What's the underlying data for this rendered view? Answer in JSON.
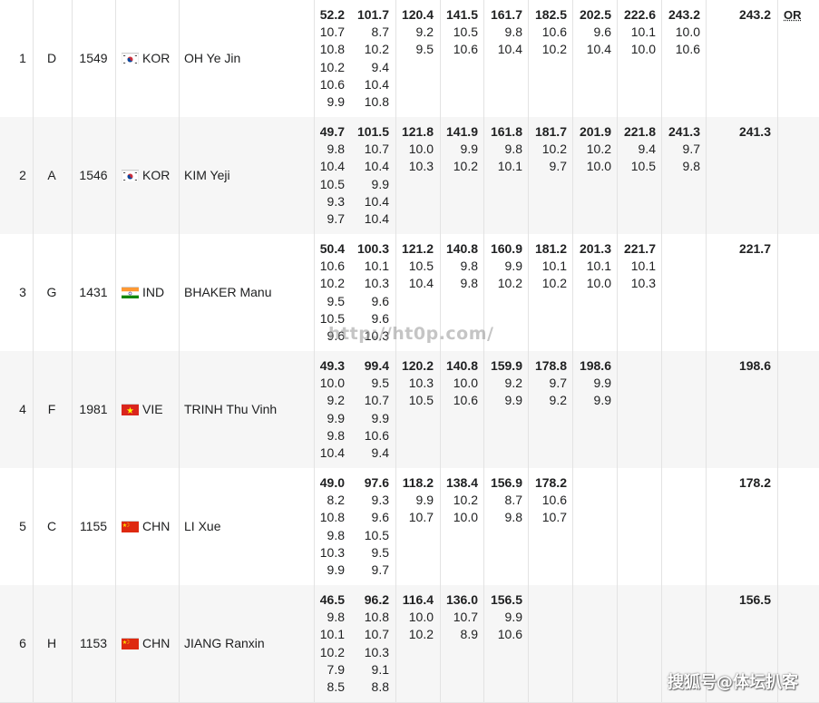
{
  "columns_note": "",
  "rows": [
    {
      "rank": "1",
      "relay": "D",
      "bib": "1549",
      "noc": "KOR",
      "flag": "korea-flag-icon",
      "name": "OH Ye Jin",
      "stages": [
        {
          "sum": "52.2",
          "shots": [
            "10.7",
            "10.8",
            "10.2",
            "10.6",
            "9.9"
          ]
        },
        {
          "sum": "101.7",
          "shots": [
            "8.7",
            "10.2",
            "9.4",
            "10.4",
            "10.8"
          ]
        },
        {
          "sum": "120.4",
          "shots": [
            "9.2",
            "9.5"
          ]
        },
        {
          "sum": "141.5",
          "shots": [
            "10.5",
            "10.6"
          ]
        },
        {
          "sum": "161.7",
          "shots": [
            "9.8",
            "10.4"
          ]
        },
        {
          "sum": "182.5",
          "shots": [
            "10.6",
            "10.2"
          ]
        },
        {
          "sum": "202.5",
          "shots": [
            "9.6",
            "10.4"
          ]
        },
        {
          "sum": "222.6",
          "shots": [
            "10.1",
            "10.0"
          ]
        },
        {
          "sum": "243.2",
          "shots": [
            "10.0",
            "10.6"
          ]
        }
      ],
      "final": "243.2",
      "note": "OR"
    },
    {
      "rank": "2",
      "relay": "A",
      "bib": "1546",
      "noc": "KOR",
      "flag": "korea-flag-icon",
      "name": "KIM Yeji",
      "stages": [
        {
          "sum": "49.7",
          "shots": [
            "9.8",
            "10.4",
            "10.5",
            "9.3",
            "9.7"
          ]
        },
        {
          "sum": "101.5",
          "shots": [
            "10.7",
            "10.4",
            "9.9",
            "10.4",
            "10.4"
          ]
        },
        {
          "sum": "121.8",
          "shots": [
            "10.0",
            "10.3"
          ]
        },
        {
          "sum": "141.9",
          "shots": [
            "9.9",
            "10.2"
          ]
        },
        {
          "sum": "161.8",
          "shots": [
            "9.8",
            "10.1"
          ]
        },
        {
          "sum": "181.7",
          "shots": [
            "10.2",
            "9.7"
          ]
        },
        {
          "sum": "201.9",
          "shots": [
            "10.2",
            "10.0"
          ]
        },
        {
          "sum": "221.8",
          "shots": [
            "9.4",
            "10.5"
          ]
        },
        {
          "sum": "241.3",
          "shots": [
            "9.7",
            "9.8"
          ]
        }
      ],
      "final": "241.3",
      "note": ""
    },
    {
      "rank": "3",
      "relay": "G",
      "bib": "1431",
      "noc": "IND",
      "flag": "india-flag-icon",
      "name": "BHAKER Manu",
      "stages": [
        {
          "sum": "50.4",
          "shots": [
            "10.6",
            "10.2",
            "9.5",
            "10.5",
            "9.6"
          ]
        },
        {
          "sum": "100.3",
          "shots": [
            "10.1",
            "10.3",
            "9.6",
            "9.6",
            "10.3"
          ]
        },
        {
          "sum": "121.2",
          "shots": [
            "10.5",
            "10.4"
          ]
        },
        {
          "sum": "140.8",
          "shots": [
            "9.8",
            "9.8"
          ]
        },
        {
          "sum": "160.9",
          "shots": [
            "9.9",
            "10.2"
          ]
        },
        {
          "sum": "181.2",
          "shots": [
            "10.1",
            "10.2"
          ]
        },
        {
          "sum": "201.3",
          "shots": [
            "10.1",
            "10.0"
          ]
        },
        {
          "sum": "221.7",
          "shots": [
            "10.1",
            "10.3"
          ]
        }
      ],
      "final": "221.7",
      "note": ""
    },
    {
      "rank": "4",
      "relay": "F",
      "bib": "1981",
      "noc": "VIE",
      "flag": "vietnam-flag-icon",
      "name": "TRINH Thu Vinh",
      "stages": [
        {
          "sum": "49.3",
          "shots": [
            "10.0",
            "9.2",
            "9.9",
            "9.8",
            "10.4"
          ]
        },
        {
          "sum": "99.4",
          "shots": [
            "9.5",
            "10.7",
            "9.9",
            "10.6",
            "9.4"
          ]
        },
        {
          "sum": "120.2",
          "shots": [
            "10.3",
            "10.5"
          ]
        },
        {
          "sum": "140.8",
          "shots": [
            "10.0",
            "10.6"
          ]
        },
        {
          "sum": "159.9",
          "shots": [
            "9.2",
            "9.9"
          ]
        },
        {
          "sum": "178.8",
          "shots": [
            "9.7",
            "9.2"
          ]
        },
        {
          "sum": "198.6",
          "shots": [
            "9.9",
            "9.9"
          ]
        }
      ],
      "final": "198.6",
      "note": ""
    },
    {
      "rank": "5",
      "relay": "C",
      "bib": "1155",
      "noc": "CHN",
      "flag": "china-flag-icon",
      "name": "LI Xue",
      "stages": [
        {
          "sum": "49.0",
          "shots": [
            "8.2",
            "10.8",
            "9.8",
            "10.3",
            "9.9"
          ]
        },
        {
          "sum": "97.6",
          "shots": [
            "9.3",
            "9.6",
            "10.5",
            "9.5",
            "9.7"
          ]
        },
        {
          "sum": "118.2",
          "shots": [
            "9.9",
            "10.7"
          ]
        },
        {
          "sum": "138.4",
          "shots": [
            "10.2",
            "10.0"
          ]
        },
        {
          "sum": "156.9",
          "shots": [
            "8.7",
            "9.8"
          ]
        },
        {
          "sum": "178.2",
          "shots": [
            "10.6",
            "10.7"
          ]
        }
      ],
      "final": "178.2",
      "note": ""
    },
    {
      "rank": "6",
      "relay": "H",
      "bib": "1153",
      "noc": "CHN",
      "flag": "china-flag-icon",
      "name": "JIANG Ranxin",
      "stages": [
        {
          "sum": "46.5",
          "shots": [
            "9.8",
            "10.1",
            "10.2",
            "7.9",
            "8.5"
          ]
        },
        {
          "sum": "96.2",
          "shots": [
            "10.8",
            "10.7",
            "10.3",
            "9.1",
            "8.8"
          ]
        },
        {
          "sum": "116.4",
          "shots": [
            "10.0",
            "10.2"
          ]
        },
        {
          "sum": "136.0",
          "shots": [
            "10.7",
            "8.9"
          ]
        },
        {
          "sum": "156.5",
          "shots": [
            "9.9",
            "10.6"
          ]
        }
      ],
      "final": "156.5",
      "note": ""
    }
  ],
  "watermark_url": "http://ht0p.com/",
  "watermark_source": "搜狐号@体坛扒客"
}
